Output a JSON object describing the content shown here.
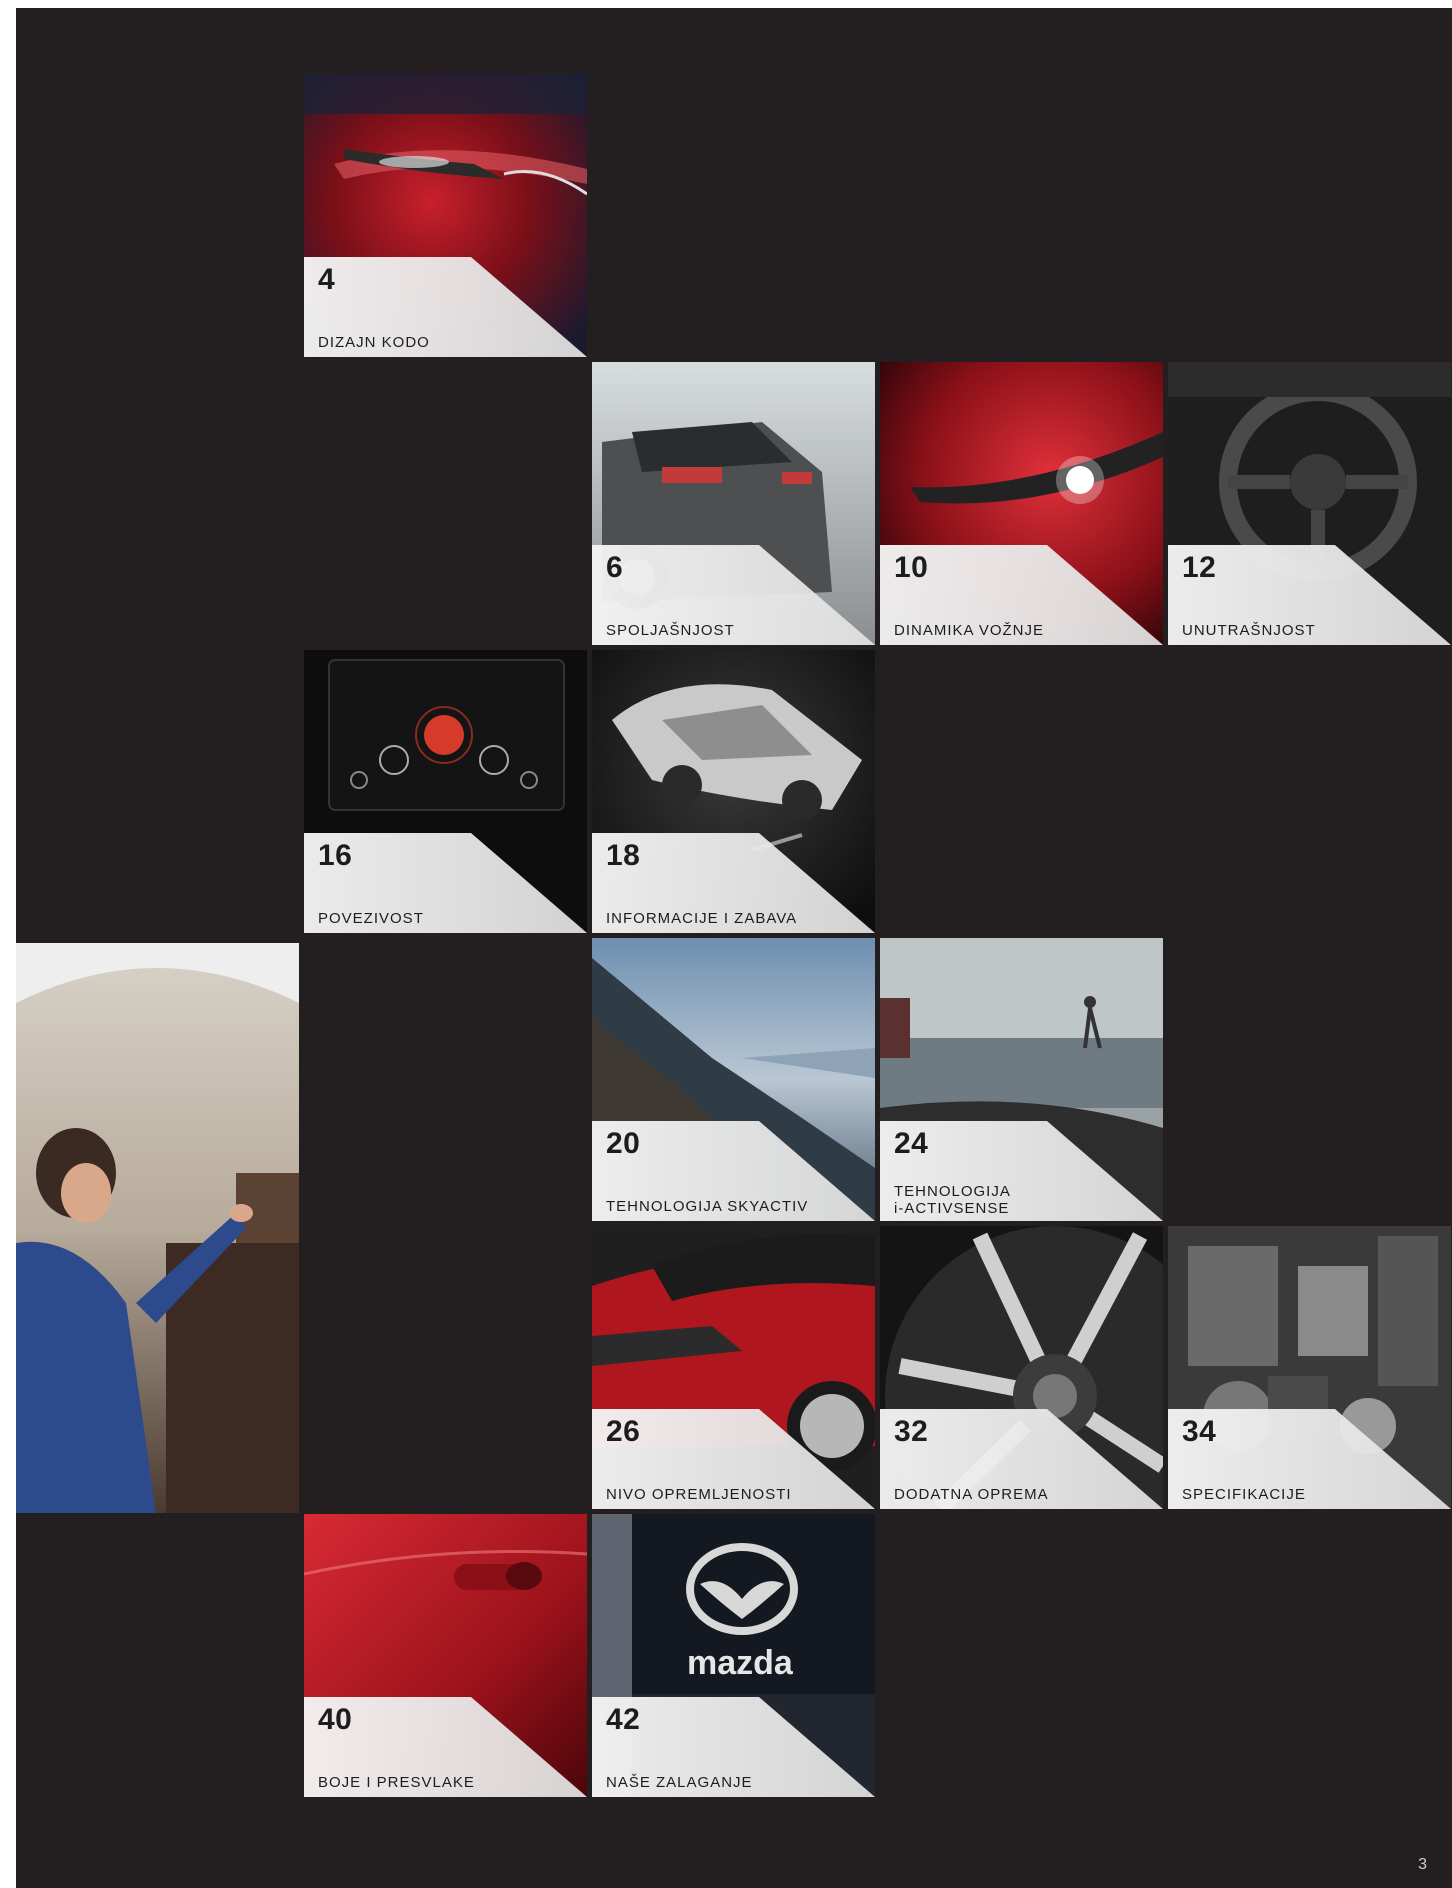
{
  "tiles": [
    {
      "number": "4",
      "title": "DIZAJN KODO"
    },
    {
      "number": "6",
      "title": "SPOLJAŠNJOST"
    },
    {
      "number": "10",
      "title": "DINAMIKA VOŽNJE"
    },
    {
      "number": "12",
      "title": "UNUTRAŠNJOST"
    },
    {
      "number": "16",
      "title": "POVEZIVOST"
    },
    {
      "number": "18",
      "title": "INFORMACIJE I ZABAVA"
    },
    {
      "number": "20",
      "title": "TEHNOLOGIJA SKYACTIV"
    },
    {
      "number": "24",
      "title_line1": "TEHNOLOGIJA",
      "title_line2": "i-ACTIVSENSE"
    },
    {
      "number": "26",
      "title": "NIVO OPREMLJENOSTI"
    },
    {
      "number": "32",
      "title": "DODATNA OPREMA"
    },
    {
      "number": "34",
      "title": "SPECIFIKACIJE"
    },
    {
      "number": "40",
      "title": "BOJE I PRESVLAKE"
    },
    {
      "number": "42",
      "title": "NAŠE ZALAGANJE"
    }
  ],
  "logo_text": "mazda",
  "page_number": "3"
}
